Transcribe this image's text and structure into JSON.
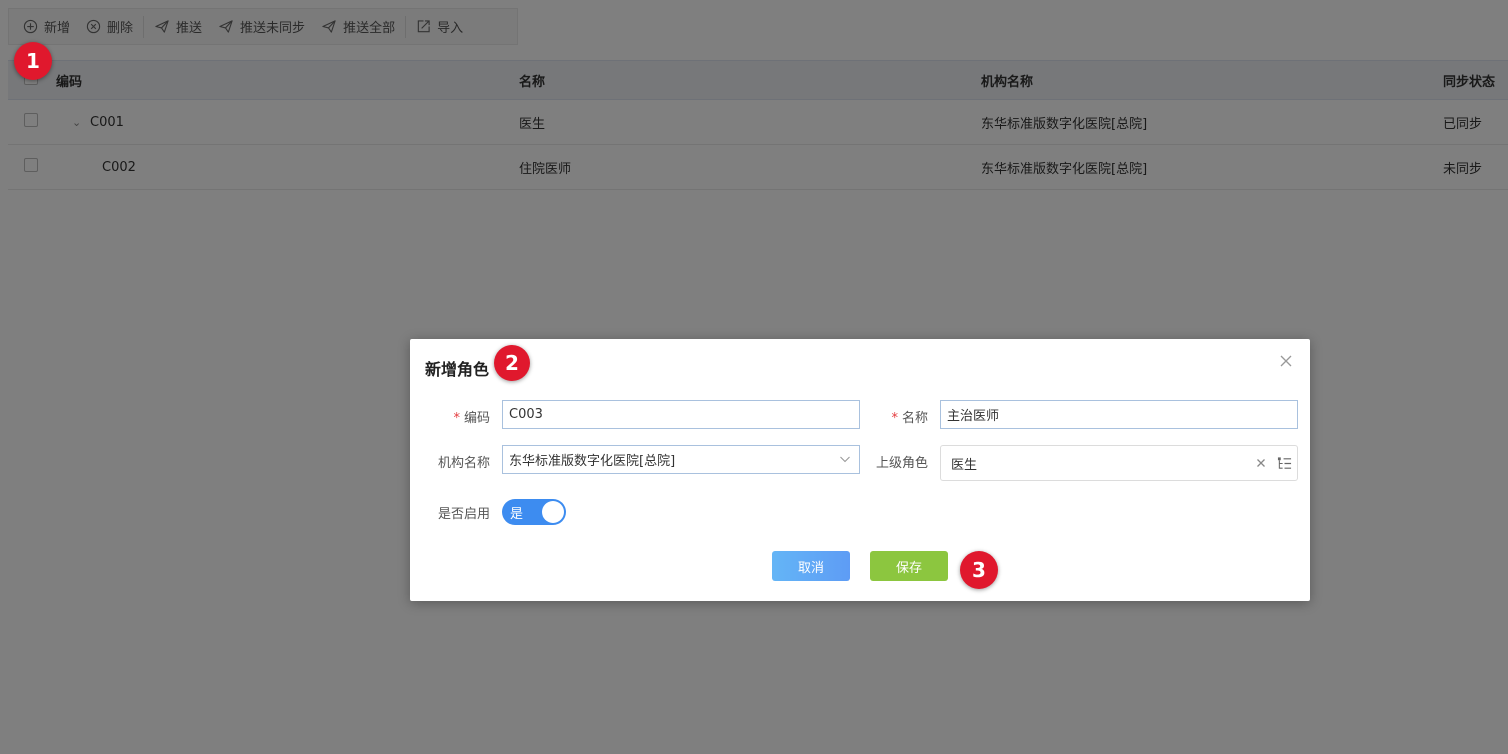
{
  "toolbar": {
    "add_label": "新增",
    "delete_label": "删除",
    "push_label": "推送",
    "push_unsynced_label": "推送未同步",
    "push_all_label": "推送全部",
    "import_label": "导入"
  },
  "table": {
    "headers": [
      "编码",
      "名称",
      "机构名称",
      "同步状态"
    ],
    "rows": [
      {
        "code": "C001",
        "name": "医生",
        "org": "东华标准版数字化医院[总院]",
        "sync": "已同步"
      },
      {
        "code": "C002",
        "name": "住院医师",
        "org": "东华标准版数字化医院[总院]",
        "sync": "未同步"
      }
    ]
  },
  "dialog": {
    "title": "新增角色",
    "code_label": "编码",
    "code_value": "C003",
    "name_label": "名称",
    "name_value": "主治医师",
    "org_label": "机构名称",
    "org_value": "东华标准版数字化医院[总院]",
    "parent_label": "上级角色",
    "parent_value": "医生",
    "enabled_label": "是否启用",
    "enabled_value": "是",
    "cancel_label": "取消",
    "save_label": "保存"
  },
  "markers": [
    "1",
    "2",
    "3"
  ],
  "colors": {
    "marker": "#e0182d",
    "toggle_on": "#3d8cf0",
    "save_button": "#8cc63f",
    "cancel_button": "#64b5f6",
    "required": "#e4393c"
  }
}
